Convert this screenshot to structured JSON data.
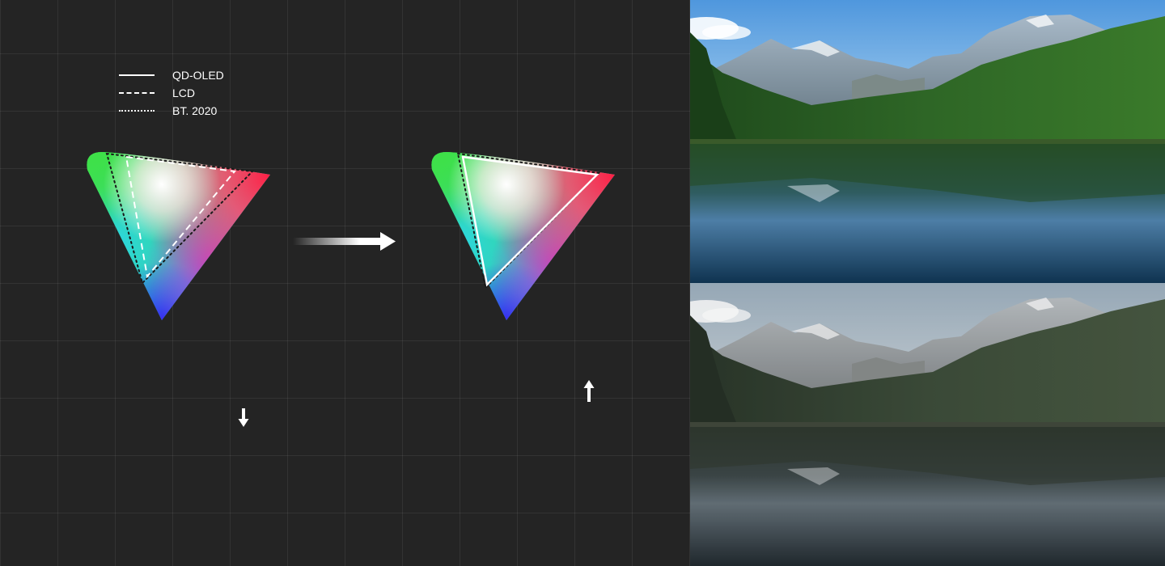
{
  "legend": {
    "items": [
      {
        "label": "QD-OLED",
        "style": "solid"
      },
      {
        "label": "LCD",
        "style": "dashed"
      },
      {
        "label": "BT. 2020",
        "style": "dotted"
      }
    ]
  },
  "colors": {
    "background": "#242424",
    "grid_line": "#3a3a3a",
    "outline": "#ffffff",
    "gamut_green": "#3ee048",
    "gamut_cyan": "#2ad6ee",
    "gamut_blue": "#3a2ff0",
    "gamut_magenta": "#d12ad2",
    "gamut_red": "#ff1f44",
    "sky": "#7fb6e4",
    "forest": "#2c5a24",
    "lake": "#214a66"
  },
  "icons": {
    "transition": "arrow-right-icon",
    "down": "arrow-down-icon",
    "up": "arrow-up-icon"
  },
  "photos": [
    {
      "scene": "mountain-lake",
      "variant": "vivid"
    },
    {
      "scene": "mountain-lake",
      "variant": "muted"
    }
  ]
}
